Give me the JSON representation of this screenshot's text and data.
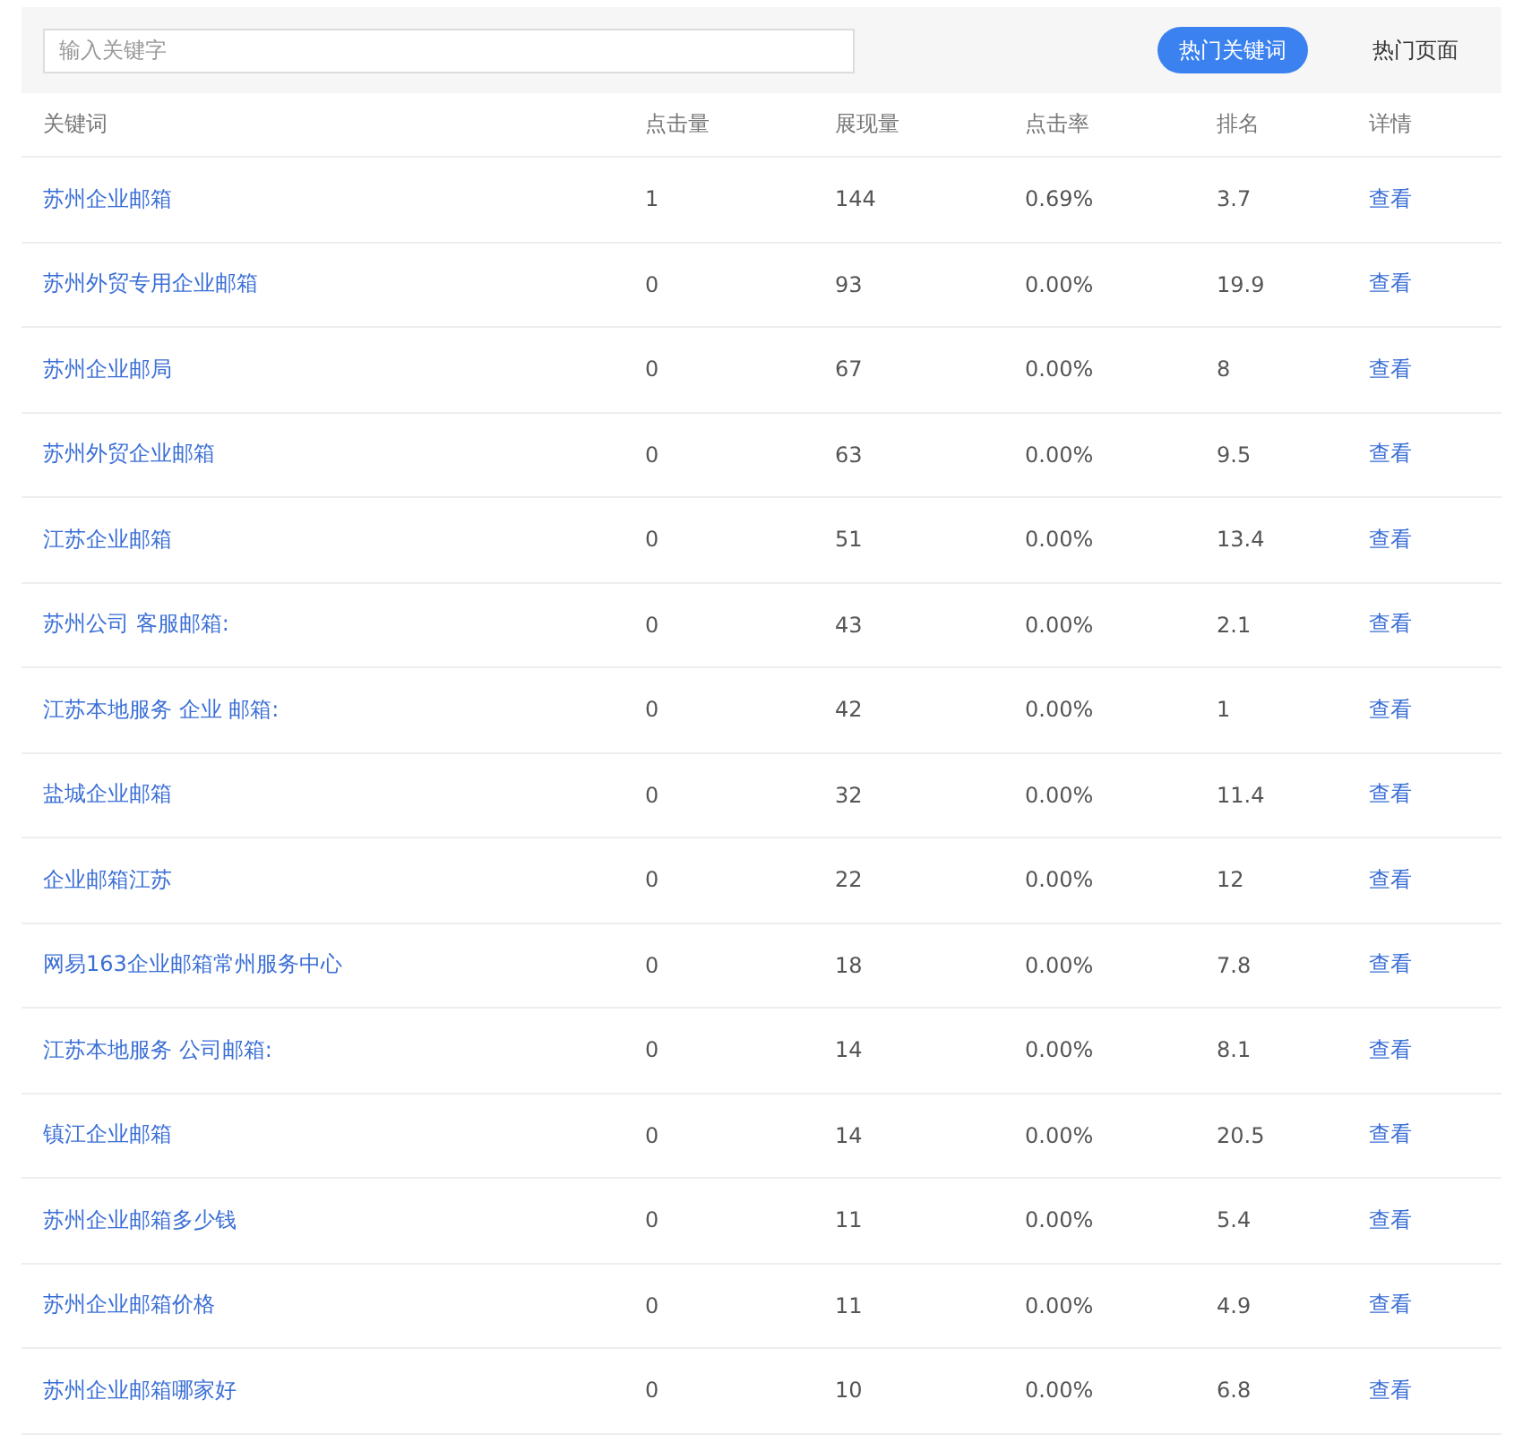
{
  "search": {
    "placeholder": "输入关键字"
  },
  "tabs": [
    {
      "label": "热门关键词",
      "selected": true
    },
    {
      "label": "热门页面",
      "selected": false
    }
  ],
  "table": {
    "columns": [
      "关键词",
      "点击量",
      "展现量",
      "点击率",
      "排名",
      "详情"
    ],
    "rows": [
      {
        "keyword": "苏州企业邮箱",
        "clicks": "1",
        "impressions": "144",
        "ctr": "0.69%",
        "rank": "3.7",
        "detail": "查看"
      },
      {
        "keyword": "苏州外贸专用企业邮箱",
        "clicks": "0",
        "impressions": "93",
        "ctr": "0.00%",
        "rank": "19.9",
        "detail": "查看"
      },
      {
        "keyword": "苏州企业邮局",
        "clicks": "0",
        "impressions": "67",
        "ctr": "0.00%",
        "rank": "8",
        "detail": "查看"
      },
      {
        "keyword": "苏州外贸企业邮箱",
        "clicks": "0",
        "impressions": "63",
        "ctr": "0.00%",
        "rank": "9.5",
        "detail": "查看"
      },
      {
        "keyword": "江苏企业邮箱",
        "clicks": "0",
        "impressions": "51",
        "ctr": "0.00%",
        "rank": "13.4",
        "detail": "查看"
      },
      {
        "keyword": "苏州公司 客服邮箱:",
        "clicks": "0",
        "impressions": "43",
        "ctr": "0.00%",
        "rank": "2.1",
        "detail": "查看"
      },
      {
        "keyword": "江苏本地服务 企业 邮箱:",
        "clicks": "0",
        "impressions": "42",
        "ctr": "0.00%",
        "rank": "1",
        "detail": "查看"
      },
      {
        "keyword": "盐城企业邮箱",
        "clicks": "0",
        "impressions": "32",
        "ctr": "0.00%",
        "rank": "11.4",
        "detail": "查看"
      },
      {
        "keyword": "企业邮箱江苏",
        "clicks": "0",
        "impressions": "22",
        "ctr": "0.00%",
        "rank": "12",
        "detail": "查看"
      },
      {
        "keyword": "网易163企业邮箱常州服务中心",
        "clicks": "0",
        "impressions": "18",
        "ctr": "0.00%",
        "rank": "7.8",
        "detail": "查看"
      },
      {
        "keyword": "江苏本地服务 公司邮箱:",
        "clicks": "0",
        "impressions": "14",
        "ctr": "0.00%",
        "rank": "8.1",
        "detail": "查看"
      },
      {
        "keyword": "镇江企业邮箱",
        "clicks": "0",
        "impressions": "14",
        "ctr": "0.00%",
        "rank": "20.5",
        "detail": "查看"
      },
      {
        "keyword": "苏州企业邮箱多少钱",
        "clicks": "0",
        "impressions": "11",
        "ctr": "0.00%",
        "rank": "5.4",
        "detail": "查看"
      },
      {
        "keyword": "苏州企业邮箱价格",
        "clicks": "0",
        "impressions": "11",
        "ctr": "0.00%",
        "rank": "4.9",
        "detail": "查看"
      },
      {
        "keyword": "苏州企业邮箱哪家好",
        "clicks": "0",
        "impressions": "10",
        "ctr": "0.00%",
        "rank": "6.8",
        "detail": "查看"
      }
    ]
  }
}
